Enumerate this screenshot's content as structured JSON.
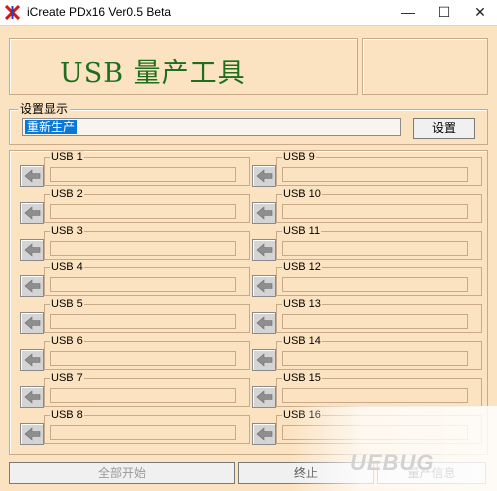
{
  "window": {
    "title": "iCreate PDx16 Ver0.5 Beta",
    "minimize_glyph": "—",
    "maximize_glyph": "☐",
    "close_glyph": "✕"
  },
  "banner": {
    "title": "USB 量产工具"
  },
  "settings": {
    "legend": "设置显示",
    "field_value": "重新生产",
    "button_label": "设置"
  },
  "ports": [
    {
      "label": "USB 1",
      "status": ""
    },
    {
      "label": "USB 2",
      "status": ""
    },
    {
      "label": "USB 3",
      "status": ""
    },
    {
      "label": "USB 4",
      "status": ""
    },
    {
      "label": "USB 5",
      "status": ""
    },
    {
      "label": "USB 6",
      "status": ""
    },
    {
      "label": "USB 7",
      "status": ""
    },
    {
      "label": "USB 8",
      "status": ""
    },
    {
      "label": "USB 9",
      "status": ""
    },
    {
      "label": "USB 10",
      "status": ""
    },
    {
      "label": "USB 11",
      "status": ""
    },
    {
      "label": "USB 12",
      "status": ""
    },
    {
      "label": "USB 13",
      "status": ""
    },
    {
      "label": "USB 14",
      "status": ""
    },
    {
      "label": "USB 15",
      "status": ""
    },
    {
      "label": "USB 16",
      "status": ""
    }
  ],
  "bottom": {
    "start_all_label": "全部开始",
    "stop_label": "终止",
    "info_label": "量产信息"
  },
  "watermark": {
    "text": "UEBUG"
  },
  "colors": {
    "background": "#fbe3c2",
    "banner_title": "#1e6e1e",
    "selection": "#0a78d7"
  },
  "icons": {
    "app": "app-logo-icon",
    "port_arrow": "arrow-left-icon"
  }
}
